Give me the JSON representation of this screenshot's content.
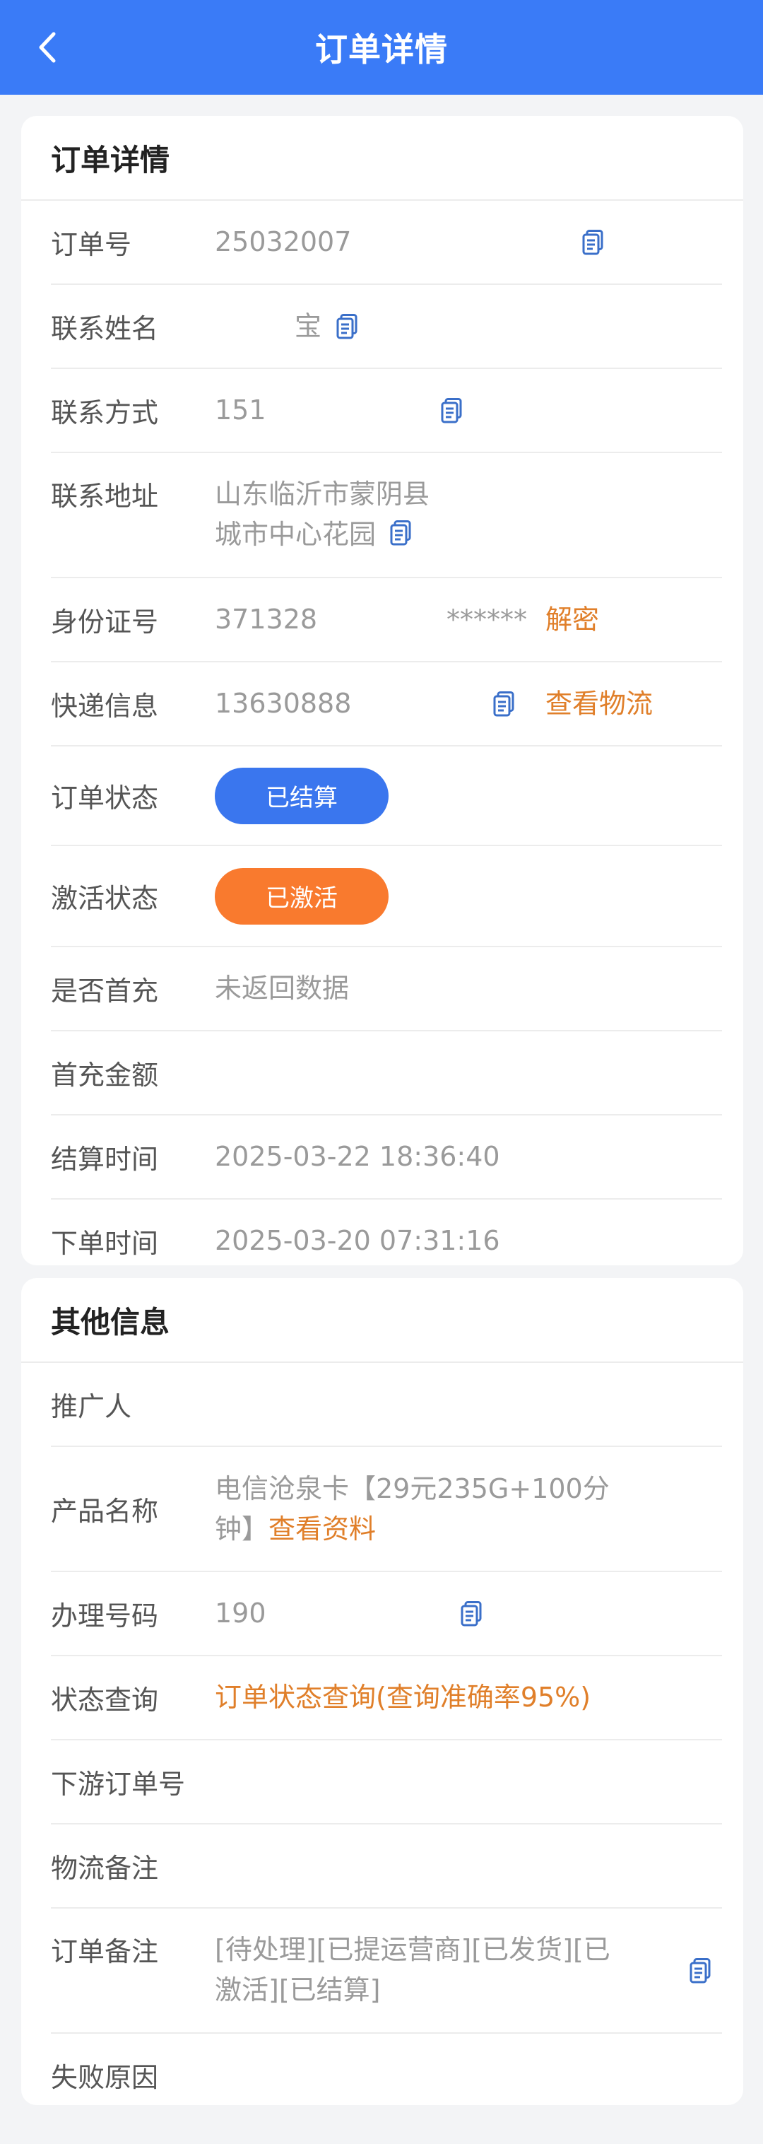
{
  "header": {
    "title": "订单详情",
    "back_icon": "chevron-left-icon"
  },
  "order_card": {
    "title": "订单详情",
    "rows": {
      "order_no": {
        "label": "订单号",
        "value": "25032007"
      },
      "contact_name": {
        "label": "联系姓名",
        "value": "宝"
      },
      "contact_phone": {
        "label": "联系方式",
        "value": "151"
      },
      "contact_address": {
        "label": "联系地址",
        "line1": "山东临沂市蒙阴县",
        "line2": "城市中心花园"
      },
      "id_number": {
        "label": "身份证号",
        "value_prefix": "371328",
        "value_suffix": "******",
        "action": "解密"
      },
      "express": {
        "label": "快递信息",
        "value": "13630888",
        "action": "查看物流"
      },
      "order_status": {
        "label": "订单状态",
        "badge": "已结算",
        "badge_color": "#3a76ee"
      },
      "activation_status": {
        "label": "激活状态",
        "badge": "已激活",
        "badge_color": "#f97a2e"
      },
      "first_recharge": {
        "label": "是否首充",
        "value": "未返回数据"
      },
      "first_amount": {
        "label": "首充金额",
        "value": ""
      },
      "settle_time": {
        "label": "结算时间",
        "value": "2025-03-22 18:36:40"
      },
      "order_time": {
        "label": "下单时间",
        "value": "2025-03-20 07:31:16"
      }
    }
  },
  "other_card": {
    "title": "其他信息",
    "rows": {
      "promoter": {
        "label": "推广人",
        "value": ""
      },
      "product": {
        "label": "产品名称",
        "line1": "电信沧泉卡【29元235G+100分",
        "line2_prefix": "钟】",
        "line2_action": "查看资料"
      },
      "number": {
        "label": "办理号码",
        "value": "190"
      },
      "status_query": {
        "label": "状态查询",
        "action": "订单状态查询(查询准确率95%)"
      },
      "downstream": {
        "label": "下游订单号",
        "value": ""
      },
      "logistics_note": {
        "label": "物流备注",
        "value": ""
      },
      "order_note": {
        "label": "订单备注",
        "line1": "[待处理][已提运营商][已发货][已",
        "line2": "激活][已结算]"
      },
      "fail_reason": {
        "label": "失败原因",
        "value": ""
      }
    }
  },
  "colors": {
    "primary": "#3a7bf7",
    "accent": "#e07f2a",
    "copy_icon": "#3a6fc9"
  }
}
